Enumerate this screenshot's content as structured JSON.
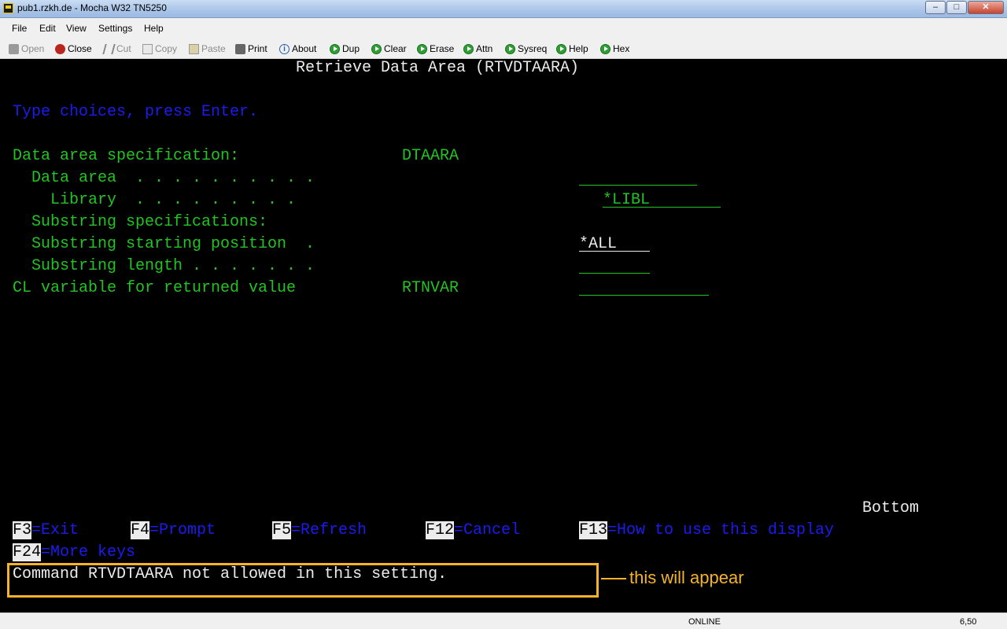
{
  "window": {
    "title": "pub1.rzkh.de - Mocha W32 TN5250",
    "controls": {
      "minimize": "–",
      "maximize": "□",
      "close": "✕"
    }
  },
  "menu": [
    "File",
    "Edit",
    "View",
    "Settings",
    "Help"
  ],
  "toolbar": {
    "open": "Open",
    "close": "Close",
    "cut": "Cut",
    "copy": "Copy",
    "paste": "Paste",
    "print": "Print",
    "about": "About",
    "dup": "Dup",
    "clear": "Clear",
    "erase": "Erase",
    "attn": "Attn",
    "sysreq": "Sysreq",
    "help": "Help",
    "hex": "Hex"
  },
  "screen": {
    "title": "Retrieve Data Area (RTVDTAARA)",
    "instruction": "Type choices, press Enter.",
    "fields": {
      "spec_label": "Data area specification:",
      "spec_keyword": "DTAARA",
      "dataarea_label": "  Data area  . . . . . . . . . .",
      "library_label": "    Library  . . . . . . . . .",
      "library_value": "*LIBL",
      "substring_spec_label": "  Substring specifications:",
      "substring_start_label": "  Substring starting position  .",
      "substring_start_value": "*ALL",
      "substring_length_label": "  Substring length . . . . . . .",
      "clvar_label": "CL variable for returned value",
      "clvar_keyword": "RTNVAR"
    },
    "bottom": "Bottom",
    "fkeys": {
      "f3_key": "F3",
      "f3_text": "=Exit",
      "f4_key": "F4",
      "f4_text": "=Prompt",
      "f5_key": "F5",
      "f5_text": "=Refresh",
      "f12_key": "F12",
      "f12_text": "=Cancel",
      "f13_key": "F13",
      "f13_text": "=How to use this display",
      "f24_key": "F24",
      "f24_text": "=More keys"
    },
    "message": "Command RTVDTAARA not allowed in this setting."
  },
  "annotation": {
    "text": "this will appear",
    "color": "#f5b32a"
  },
  "status": {
    "connection": "ONLINE",
    "cursor": "6,50"
  },
  "colors": {
    "green": "#22c322",
    "blue": "#1c1cf0",
    "white": "#ececec",
    "background": "#000000"
  }
}
